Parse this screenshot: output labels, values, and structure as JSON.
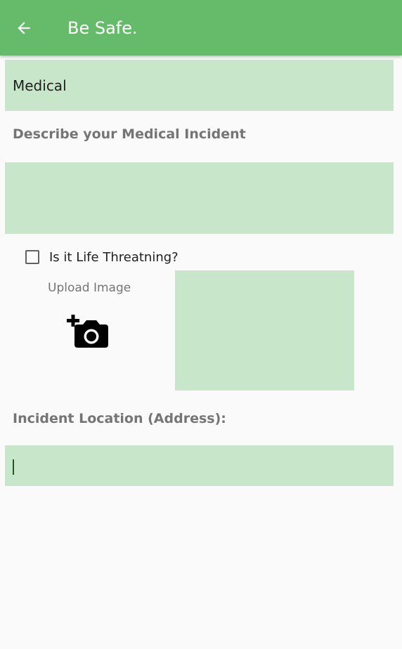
{
  "app_bar": {
    "title": "Be Safe.",
    "back_icon": "arrow-left-icon",
    "color": "#66bb6a"
  },
  "form": {
    "category_value": "Medical",
    "description_label": "Describe your Medical Incident",
    "description_value": "",
    "life_threatening_label": "Is it Life Threatning?",
    "life_threatening_checked": false,
    "upload_label": "Upload Image",
    "upload_icon": "add-a-photo-icon",
    "location_label": "Incident Location (Address):",
    "location_value": ""
  },
  "colors": {
    "field_background": "#c8e6c9",
    "page_background": "#fafafa"
  }
}
